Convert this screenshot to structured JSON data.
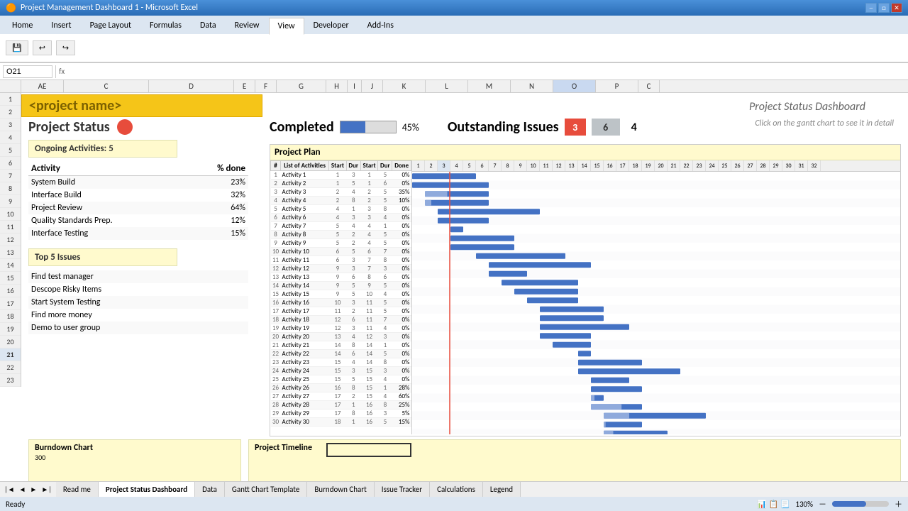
{
  "titlebar": {
    "title": "Project Management Dashboard 1 - Microsoft Excel",
    "minimize": "─",
    "restore": "□",
    "close": "✕"
  },
  "ribbon": {
    "tabs": [
      "Home",
      "Insert",
      "Page Layout",
      "Formulas",
      "Data",
      "Review",
      "View",
      "Developer",
      "Add-Ins"
    ],
    "active_tab": "Home"
  },
  "cell_ref": "O21",
  "dashboard": {
    "subtitle": "Project Status Dashboard",
    "project_name": "<project name>",
    "project_status_label": "Project Status",
    "completed_label": "Completed",
    "completed_pct": "45%",
    "outstanding_label": "Outstanding Issues",
    "outstanding_red": "3",
    "outstanding_gray": "6",
    "outstanding_num": "4",
    "ongoing_label": "Ongoing Activities: 5",
    "activity_col1": "Activity",
    "activity_col2": "% done",
    "activities": [
      {
        "name": "System Build",
        "pct": "23%"
      },
      {
        "name": "Interface Build",
        "pct": "32%"
      },
      {
        "name": "Project Review",
        "pct": "64%"
      },
      {
        "name": "Quality Standards Prep.",
        "pct": "12%"
      },
      {
        "name": "Interface Testing",
        "pct": "15%"
      }
    ],
    "top5_label": "Top 5 Issues",
    "issues": [
      "Find test manager",
      "Descope Risky Items",
      "Start System Testing",
      "Find more money",
      "Demo to user group"
    ],
    "gantt_title": "Project Plan",
    "gantt_hint": "Click on the gantt chart to see it in detail",
    "gantt_headers": [
      "#",
      "List of Activities",
      "Start",
      "Dur",
      "Start",
      "Dur",
      "Done"
    ],
    "gantt_cols": [
      1,
      2,
      3,
      4,
      5,
      6,
      7,
      8,
      9,
      10,
      11,
      12,
      13,
      14,
      15,
      16,
      17,
      18,
      19,
      20,
      21,
      22,
      23,
      24,
      25,
      26,
      27,
      28,
      29,
      30,
      31,
      32
    ],
    "activities_gantt": [
      {
        "num": 1,
        "name": "Activity 1",
        "s1": 1,
        "d1": 3,
        "s2": 1,
        "d2": 5,
        "done": "0%"
      },
      {
        "num": 2,
        "name": "Activity 2",
        "s1": 1,
        "d1": 5,
        "s2": 1,
        "d2": 6,
        "done": "0%"
      },
      {
        "num": 3,
        "name": "Activity 3",
        "s1": 2,
        "d1": 4,
        "s2": 2,
        "d2": 5,
        "done": "35%"
      },
      {
        "num": 4,
        "name": "Activity 4",
        "s1": 2,
        "d1": 8,
        "s2": 2,
        "d2": 5,
        "done": "10%"
      },
      {
        "num": 5,
        "name": "Activity 5",
        "s1": 4,
        "d1": 1,
        "s2": 3,
        "d2": 8,
        "done": "0%"
      },
      {
        "num": 6,
        "name": "Activity 6",
        "s1": 4,
        "d1": 3,
        "s2": 3,
        "d2": 4,
        "done": "0%"
      },
      {
        "num": 7,
        "name": "Activity 7",
        "s1": 5,
        "d1": 4,
        "s2": 4,
        "d2": 1,
        "done": "0%"
      },
      {
        "num": 8,
        "name": "Activity 8",
        "s1": 5,
        "d1": 2,
        "s2": 4,
        "d2": 5,
        "done": "0%"
      },
      {
        "num": 9,
        "name": "Activity 9",
        "s1": 5,
        "d1": 2,
        "s2": 4,
        "d2": 5,
        "done": "0%"
      },
      {
        "num": 10,
        "name": "Activity 10",
        "s1": 6,
        "d1": 5,
        "s2": 6,
        "d2": 7,
        "done": "0%"
      },
      {
        "num": 11,
        "name": "Activity 11",
        "s1": 6,
        "d1": 3,
        "s2": 7,
        "d2": 8,
        "done": "0%"
      },
      {
        "num": 12,
        "name": "Activity 12",
        "s1": 9,
        "d1": 3,
        "s2": 7,
        "d2": 3,
        "done": "0%"
      },
      {
        "num": 13,
        "name": "Activity 13",
        "s1": 9,
        "d1": 6,
        "s2": 8,
        "d2": 6,
        "done": "0%"
      },
      {
        "num": 14,
        "name": "Activity 14",
        "s1": 9,
        "d1": 5,
        "s2": 9,
        "d2": 5,
        "done": "0%"
      },
      {
        "num": 15,
        "name": "Activity 15",
        "s1": 9,
        "d1": 5,
        "s2": 10,
        "d2": 4,
        "done": "0%"
      },
      {
        "num": 16,
        "name": "Activity 16",
        "s1": 10,
        "d1": 3,
        "s2": 11,
        "d2": 5,
        "done": "0%"
      },
      {
        "num": 17,
        "name": "Activity 17",
        "s1": 11,
        "d1": 2,
        "s2": 11,
        "d2": 5,
        "done": "0%"
      },
      {
        "num": 18,
        "name": "Activity 18",
        "s1": 12,
        "d1": 6,
        "s2": 11,
        "d2": 7,
        "done": "0%"
      },
      {
        "num": 19,
        "name": "Activity 19",
        "s1": 12,
        "d1": 3,
        "s2": 11,
        "d2": 4,
        "done": "0%"
      },
      {
        "num": 20,
        "name": "Activity 20",
        "s1": 13,
        "d1": 4,
        "s2": 12,
        "d2": 3,
        "done": "0%"
      },
      {
        "num": 21,
        "name": "Activity 21",
        "s1": 14,
        "d1": 8,
        "s2": 14,
        "d2": 1,
        "done": "0%"
      },
      {
        "num": 22,
        "name": "Activity 22",
        "s1": 14,
        "d1": 6,
        "s2": 14,
        "d2": 5,
        "done": "0%"
      },
      {
        "num": 23,
        "name": "Activity 23",
        "s1": 15,
        "d1": 4,
        "s2": 14,
        "d2": 8,
        "done": "0%"
      },
      {
        "num": 24,
        "name": "Activity 24",
        "s1": 15,
        "d1": 3,
        "s2": 15,
        "d2": 3,
        "done": "0%"
      },
      {
        "num": 25,
        "name": "Activity 25",
        "s1": 15,
        "d1": 5,
        "s2": 15,
        "d2": 4,
        "done": "0%"
      },
      {
        "num": 26,
        "name": "Activity 26",
        "s1": 16,
        "d1": 8,
        "s2": 15,
        "d2": 1,
        "done": "28%"
      },
      {
        "num": 27,
        "name": "Activity 27",
        "s1": 17,
        "d1": 2,
        "s2": 15,
        "d2": 4,
        "done": "60%"
      },
      {
        "num": 28,
        "name": "Activity 28",
        "s1": 17,
        "d1": 1,
        "s2": 16,
        "d2": 8,
        "done": "25%"
      },
      {
        "num": 29,
        "name": "Activity 29",
        "s1": 17,
        "d1": 8,
        "s2": 16,
        "d2": 3,
        "done": "5%"
      },
      {
        "num": 30,
        "name": "Activity 30",
        "s1": 18,
        "d1": 1,
        "s2": 16,
        "d2": 5,
        "done": "15%"
      }
    ],
    "burndown_title": "Burndown Chart",
    "burndown_val": "300",
    "timeline_title": "Project Timeline"
  },
  "sheet_tabs": [
    "Read me",
    "Project Status Dashboard",
    "Data",
    "Gantt Chart Template",
    "Burndown Chart",
    "Issue Tracker",
    "Calculations",
    "Legend"
  ],
  "active_sheet": "Project Status Dashboard",
  "status": {
    "ready": "Ready",
    "zoom": "130%"
  }
}
